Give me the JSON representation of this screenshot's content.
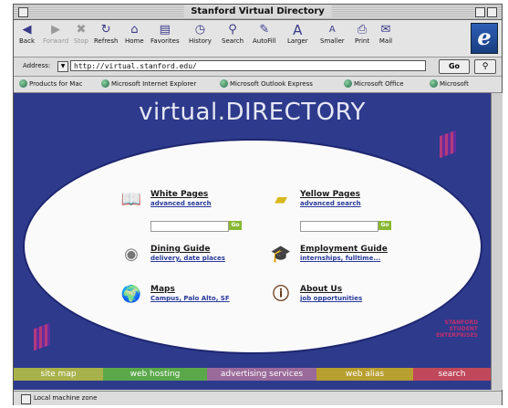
{
  "window": {
    "title": "Stanford Virtual Directory"
  },
  "toolbar": {
    "buttons": [
      {
        "label": "Back",
        "icon": "back-arrow-icon",
        "glyph": "◀"
      },
      {
        "label": "Forward",
        "icon": "forward-arrow-icon",
        "glyph": "▶"
      },
      {
        "label": "Stop",
        "icon": "stop-icon",
        "glyph": "✖"
      },
      {
        "label": "Refresh",
        "icon": "refresh-icon",
        "glyph": "↻"
      },
      {
        "label": "Home",
        "icon": "home-icon",
        "glyph": "⌂"
      },
      {
        "label": "Favorites",
        "icon": "favorites-icon",
        "glyph": "▤"
      },
      {
        "label": "History",
        "icon": "history-icon",
        "glyph": "◷"
      },
      {
        "label": "Search",
        "icon": "search-icon",
        "glyph": "⚲"
      },
      {
        "label": "AutoFill",
        "icon": "autofill-icon",
        "glyph": "✎"
      },
      {
        "label": "Larger",
        "icon": "larger-text-icon",
        "glyph": "A"
      },
      {
        "label": "Smaller",
        "icon": "smaller-text-icon",
        "glyph": "A"
      },
      {
        "label": "Print",
        "icon": "print-icon",
        "glyph": "⎙"
      },
      {
        "label": "Mail",
        "icon": "mail-icon",
        "glyph": "✉"
      }
    ],
    "browser_logo": "e"
  },
  "address": {
    "label": "Address:",
    "url": "http://virtual.stanford.edu/",
    "go_label": "Go"
  },
  "favorites": [
    "Products for Mac",
    "Microsoft Internet Explorer",
    "Microsoft Outlook Express",
    "Microsoft Office",
    "Microsoft"
  ],
  "page": {
    "title": "virtual.DIRECTORY",
    "services": {
      "white_pages": {
        "title": "White Pages",
        "subtitle": "advanced search",
        "icon": "book-icon"
      },
      "yellow_pages": {
        "title": "Yellow Pages",
        "subtitle": "advanced search",
        "icon": "yellow-book-icon"
      },
      "dining": {
        "title": "Dining Guide",
        "subtitle": "delivery, date places",
        "icon": "dining-plate-icon"
      },
      "employment": {
        "title": "Employment Guide",
        "subtitle": "internships, fulltime...",
        "icon": "graduation-cap-icon"
      },
      "maps": {
        "title": "Maps",
        "subtitle": "Campus, Palo Alto, SF",
        "icon": "globe-icon"
      },
      "about": {
        "title": "About Us",
        "subtitle": "job opportunities",
        "icon": "info-icon"
      }
    },
    "search_go_label": "Go",
    "brand_text": "STANFORD STUDENT ENTERPRISES",
    "bottom_nav": [
      {
        "label": "site map",
        "color": "#a8b24a"
      },
      {
        "label": "web hosting",
        "color": "#5aa84a"
      },
      {
        "label": "advertising services",
        "color": "#9a6a9a"
      },
      {
        "label": "web alias",
        "color": "#b8a030"
      },
      {
        "label": "search",
        "color": "#c0485a"
      }
    ]
  },
  "status": {
    "zone": "Local machine zone"
  }
}
